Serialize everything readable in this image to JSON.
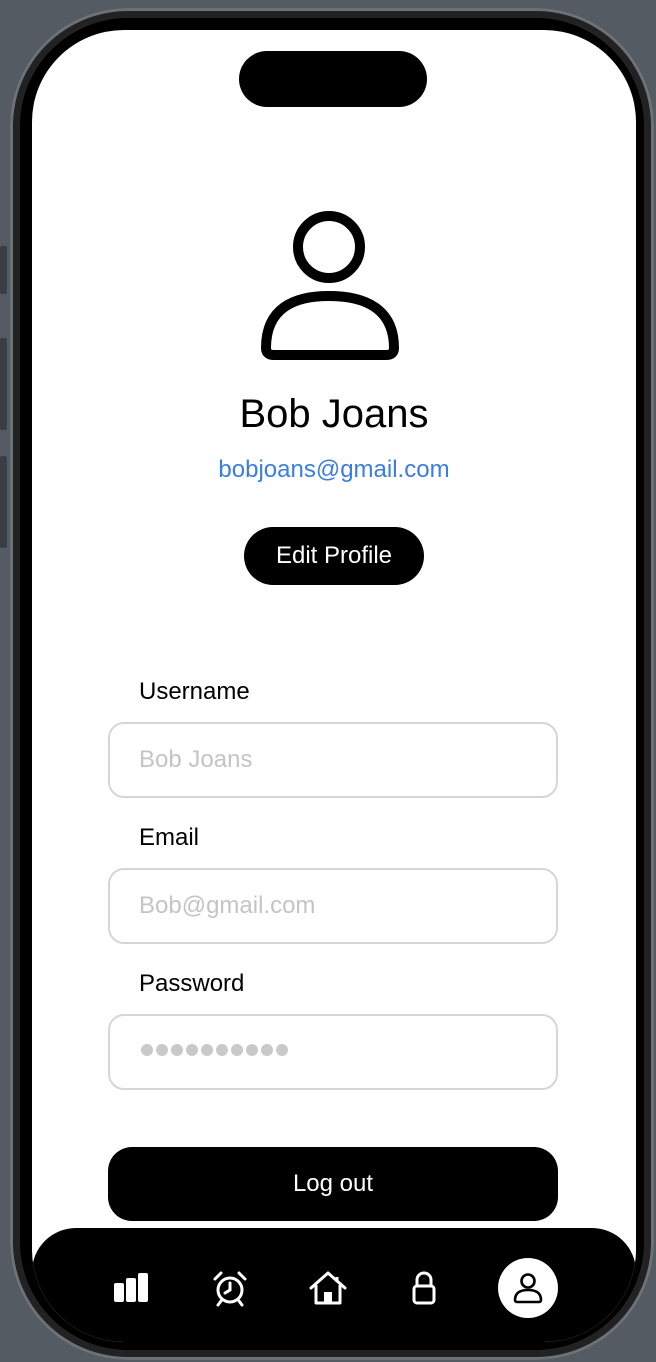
{
  "profile": {
    "name": "Bob Joans",
    "email": "bobjoans@gmail.com",
    "edit_label": "Edit Profile",
    "avatar_icon": "person-icon"
  },
  "form": {
    "username_label": "Username",
    "username_placeholder": "Bob Joans",
    "email_label": "Email",
    "email_placeholder": "Bob@gmail.com",
    "password_label": "Password",
    "password_length": 10
  },
  "logout_label": "Log out",
  "tabbar": {
    "items": [
      {
        "icon": "bar-chart-icon",
        "active": false
      },
      {
        "icon": "alarm-clock-icon",
        "active": false
      },
      {
        "icon": "home-icon",
        "active": false
      },
      {
        "icon": "lock-icon",
        "active": false
      },
      {
        "icon": "person-icon",
        "active": true
      }
    ]
  },
  "colors": {
    "accent": "#3b7de0",
    "button": "#000000",
    "field_border": "#d6d6d6",
    "placeholder": "#c4c4c4"
  }
}
